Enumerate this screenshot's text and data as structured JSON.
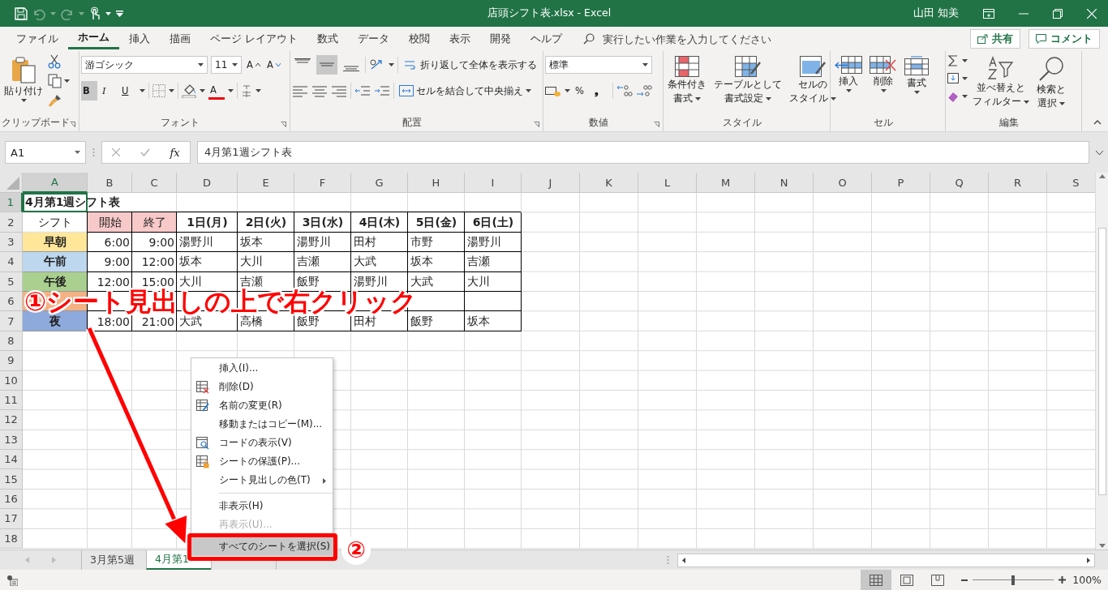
{
  "title_bar": {
    "title": "店頭シフト表.xlsx  -  Excel",
    "user": "山田 知美"
  },
  "ribbon_tabs": [
    {
      "label": "ファイル",
      "selected": false
    },
    {
      "label": "ホーム",
      "selected": true
    },
    {
      "label": "挿入",
      "selected": false
    },
    {
      "label": "描画",
      "selected": false
    },
    {
      "label": "ページ レイアウト",
      "selected": false
    },
    {
      "label": "数式",
      "selected": false
    },
    {
      "label": "データ",
      "selected": false
    },
    {
      "label": "校閲",
      "selected": false
    },
    {
      "label": "表示",
      "selected": false
    },
    {
      "label": "開発",
      "selected": false
    },
    {
      "label": "ヘルプ",
      "selected": false
    }
  ],
  "tell_me": {
    "placeholder": "実行したい作業を入力してください"
  },
  "share_button": "共有",
  "comment_button": "コメント",
  "ribbon": {
    "clipboard": {
      "paste": "貼り付け",
      "label": "クリップボード"
    },
    "font": {
      "name": "游ゴシック",
      "size": "11",
      "grow": "A",
      "shrink": "A",
      "bold": "B",
      "italic": "I",
      "underline": "U",
      "font_color": "A",
      "label": "フォント"
    },
    "alignment": {
      "vertical": [
        {
          "selected": false
        },
        {
          "selected": true
        },
        {
          "selected": false
        }
      ],
      "wrap": "折り返して全体を表示する",
      "merge": "セルを結合して中央揃え",
      "label": "配置"
    },
    "number": {
      "format": "標準",
      "percent": "%",
      "comma": "❟",
      "label": "数値"
    },
    "styles": {
      "buttons": [
        [
          "条件付き",
          "書式"
        ],
        [
          "テーブルとして",
          "書式設定"
        ],
        [
          "セルの",
          "スタイル"
        ]
      ],
      "label": "スタイル"
    },
    "cells": {
      "buttons": [
        "挿入",
        "削除",
        "書式"
      ],
      "label": "セル"
    },
    "editing": {
      "buttons": [
        [
          "並べ替えと",
          "フィルター"
        ],
        [
          "検索と",
          "選択"
        ]
      ],
      "label": "編集"
    }
  },
  "formula_bar": {
    "name_box": "A1",
    "function_label": "fx",
    "formula": "4月第1週シフト表"
  },
  "columns": [
    {
      "label": "A",
      "selected": true
    },
    {
      "label": "B",
      "selected": false
    },
    {
      "label": "C",
      "selected": false
    },
    {
      "label": "D",
      "selected": false
    },
    {
      "label": "E",
      "selected": false
    },
    {
      "label": "F",
      "selected": false
    },
    {
      "label": "G",
      "selected": false
    },
    {
      "label": "H",
      "selected": false
    },
    {
      "label": "I",
      "selected": false
    },
    {
      "label": "J",
      "selected": false
    },
    {
      "label": "K",
      "selected": false
    },
    {
      "label": "L",
      "selected": false
    },
    {
      "label": "M",
      "selected": false
    },
    {
      "label": "N",
      "selected": false
    },
    {
      "label": "O",
      "selected": false
    },
    {
      "label": "P",
      "selected": false
    },
    {
      "label": "Q",
      "selected": false
    },
    {
      "label": "R",
      "selected": false
    },
    {
      "label": "S",
      "selected": false
    }
  ],
  "rows": [
    {
      "label": "1",
      "selected": true,
      "cells": [
        {
          "kind": "title",
          "text": "4月第1週シフト表",
          "selected": true
        }
      ]
    },
    {
      "label": "2",
      "selected": false,
      "cells": [
        {
          "kind": "plain",
          "text": "シフト",
          "selected": false
        },
        {
          "kind": "head",
          "text": "開始",
          "color": "#f8c9c9",
          "selected": false
        },
        {
          "kind": "head",
          "text": "終了",
          "color": "#f8c9c9",
          "selected": false
        },
        {
          "kind": "header",
          "text": "1日(月)",
          "selected": false
        },
        {
          "kind": "header",
          "text": "2日(火)",
          "selected": false
        },
        {
          "kind": "header",
          "text": "3日(水)",
          "selected": false
        },
        {
          "kind": "header",
          "text": "4日(木)",
          "selected": false
        },
        {
          "kind": "header",
          "text": "5日(金)",
          "selected": false
        },
        {
          "kind": "header",
          "text": "6日(土)",
          "selected": false
        }
      ]
    },
    {
      "label": "3",
      "selected": false,
      "cells": [
        {
          "kind": "label",
          "text": "早朝",
          "color": "#ffe699",
          "selected": false
        },
        {
          "kind": "time",
          "text": "6:00",
          "selected": false
        },
        {
          "kind": "time",
          "text": "9:00",
          "selected": false
        },
        {
          "kind": "name",
          "text": "湯野川",
          "selected": false
        },
        {
          "kind": "name",
          "text": "坂本",
          "selected": false
        },
        {
          "kind": "name",
          "text": "湯野川",
          "selected": false
        },
        {
          "kind": "name",
          "text": "田村",
          "selected": false
        },
        {
          "kind": "name",
          "text": "市野",
          "selected": false
        },
        {
          "kind": "name",
          "text": "湯野川",
          "selected": false
        }
      ]
    },
    {
      "label": "4",
      "selected": false,
      "cells": [
        {
          "kind": "label",
          "text": "午前",
          "color": "#bdd7ee",
          "selected": false
        },
        {
          "kind": "time",
          "text": "9:00",
          "selected": false
        },
        {
          "kind": "time",
          "text": "12:00",
          "selected": false
        },
        {
          "kind": "name",
          "text": "坂本",
          "selected": false
        },
        {
          "kind": "name",
          "text": "大川",
          "selected": false
        },
        {
          "kind": "name",
          "text": "吉瀬",
          "selected": false
        },
        {
          "kind": "name",
          "text": "大武",
          "selected": false
        },
        {
          "kind": "name",
          "text": "坂本",
          "selected": false
        },
        {
          "kind": "name",
          "text": "吉瀬",
          "selected": false
        }
      ]
    },
    {
      "label": "5",
      "selected": false,
      "cells": [
        {
          "kind": "label",
          "text": "午後",
          "color": "#a9d08e",
          "selected": false
        },
        {
          "kind": "time",
          "text": "12:00",
          "selected": false
        },
        {
          "kind": "time",
          "text": "15:00",
          "selected": false
        },
        {
          "kind": "name",
          "text": "大川",
          "selected": false
        },
        {
          "kind": "name",
          "text": "吉瀬",
          "selected": false
        },
        {
          "kind": "name",
          "text": "飯野",
          "selected": false
        },
        {
          "kind": "name",
          "text": "湯野川",
          "selected": false
        },
        {
          "kind": "name",
          "text": "大武",
          "selected": false
        },
        {
          "kind": "name",
          "text": "大川",
          "selected": false
        }
      ]
    },
    {
      "label": "6",
      "selected": false,
      "cells": [
        {
          "kind": "label",
          "color": "#f4b183",
          "selected": false
        },
        {
          "kind": "time",
          "selected": false
        },
        {
          "kind": "time",
          "selected": false
        },
        {
          "kind": "name",
          "selected": false
        },
        {
          "kind": "name",
          "selected": false
        },
        {
          "kind": "name",
          "selected": false
        },
        {
          "kind": "name",
          "selected": false
        },
        {
          "kind": "name",
          "selected": false
        },
        {
          "kind": "name",
          "selected": false
        }
      ]
    },
    {
      "label": "7",
      "selected": false,
      "cells": [
        {
          "kind": "label",
          "text": "夜",
          "color": "#8ea9db",
          "selected": false
        },
        {
          "kind": "time",
          "text": "18:00",
          "selected": false
        },
        {
          "kind": "time",
          "text": "21:00",
          "selected": false
        },
        {
          "kind": "name",
          "text": "大武",
          "selected": false
        },
        {
          "kind": "name",
          "text": "高橋",
          "selected": false
        },
        {
          "kind": "name",
          "text": "飯野",
          "selected": false
        },
        {
          "kind": "name",
          "text": "田村",
          "selected": false
        },
        {
          "kind": "name",
          "text": "飯野",
          "selected": false
        },
        {
          "kind": "name",
          "text": "坂本",
          "selected": false
        }
      ]
    },
    {
      "label": "8",
      "selected": false
    },
    {
      "label": "9",
      "selected": false
    },
    {
      "label": "10",
      "selected": false
    },
    {
      "label": "11",
      "selected": false
    },
    {
      "label": "12",
      "selected": false
    },
    {
      "label": "13",
      "selected": false
    },
    {
      "label": "14",
      "selected": false
    },
    {
      "label": "15",
      "selected": false
    },
    {
      "label": "16",
      "selected": false
    },
    {
      "label": "17",
      "selected": false
    },
    {
      "label": "18",
      "selected": false
    }
  ],
  "context_menu": [
    {
      "kind": "plain",
      "label": "挿入(I)...",
      "disabled": false,
      "submenu": false,
      "selected": false
    },
    {
      "kind": "delete",
      "label": "削除(D)",
      "disabled": false,
      "submenu": false,
      "selected": false
    },
    {
      "kind": "rename",
      "label": "名前の変更(R)",
      "disabled": false,
      "submenu": false,
      "selected": false
    },
    {
      "kind": "plain",
      "label": "移動またはコピー(M)...",
      "disabled": false,
      "submenu": false,
      "selected": false
    },
    {
      "kind": "code",
      "label": "コードの表示(V)",
      "disabled": false,
      "submenu": false,
      "selected": false
    },
    {
      "kind": "protect",
      "label": "シートの保護(P)...",
      "disabled": false,
      "submenu": false,
      "selected": false
    },
    {
      "kind": "plain",
      "label": "シート見出しの色(T)",
      "disabled": false,
      "submenu": true,
      "selected": false
    },
    {
      "kind": "separator"
    },
    {
      "kind": "plain",
      "label": "非表示(H)",
      "disabled": false,
      "submenu": false,
      "selected": false
    },
    {
      "kind": "plain",
      "label": "再表示(U)...",
      "disabled": true,
      "submenu": false,
      "selected": false
    },
    {
      "kind": "plain",
      "label": "すべてのシートを選択(S)",
      "disabled": false,
      "submenu": false,
      "selected": true
    }
  ],
  "sheet_tabs": [
    {
      "label": "3月第5週",
      "selected": false
    },
    {
      "label": "4月第1",
      "selected": true
    },
    {
      "selected": false
    },
    {
      "selected": false
    }
  ],
  "annotations": {
    "step_1": "①シート見出しの上で右クリック",
    "step_2": "②"
  },
  "status_bar": {
    "zoom": "100%",
    "zoom_slider": {
      "level": 0.5
    },
    "views": [
      {
        "selected": true
      },
      {
        "selected": false
      },
      {
        "selected": false
      }
    ]
  }
}
